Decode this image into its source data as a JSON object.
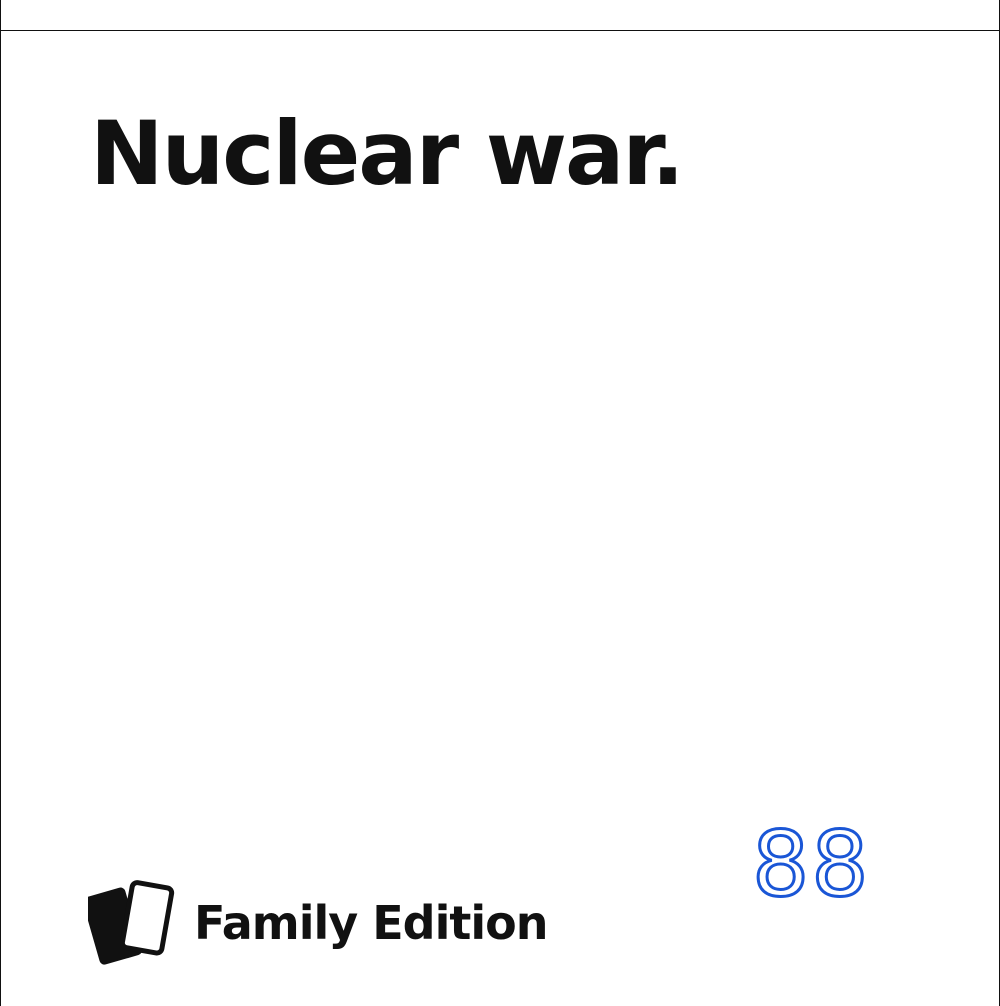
{
  "card": {
    "text": "Nuclear war."
  },
  "brand": {
    "label": "Family Edition",
    "icon": "stacked-cards-icon"
  },
  "overlay": {
    "number": "88",
    "color": "#1a56d6"
  },
  "colors": {
    "text": "#111111",
    "background": "#ffffff"
  }
}
